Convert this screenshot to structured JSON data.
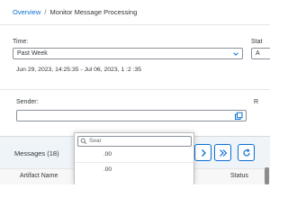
{
  "breadcrumb": {
    "link_label": "Overview",
    "separator": "/",
    "current": "Monitor Message Processing"
  },
  "filters": {
    "time": {
      "label": "Time:",
      "value": "Past Week",
      "range_text": "Jun 29, 2023, 14:25:35 - Jul 06, 2023, 1 :2 :35"
    },
    "status": {
      "label": "Stat",
      "value": "A"
    },
    "sender": {
      "label": "Sender:",
      "value": ""
    },
    "receiver_label": "R"
  },
  "messages": {
    "title": "Messages (18)"
  },
  "table": {
    "columns": [
      "Artifact Name",
      "Status"
    ]
  },
  "dropdown": {
    "search_placeholder": "Sear",
    "items": [
      ".00",
      ".00"
    ]
  },
  "colors": {
    "link": "#0a6ed1",
    "toolbar_bg": "#eff4f9",
    "text": "#32363a"
  }
}
